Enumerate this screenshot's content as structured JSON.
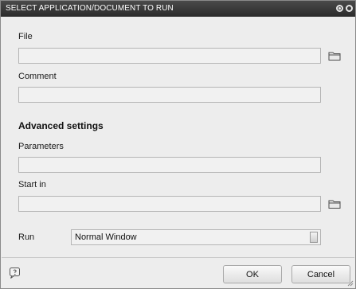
{
  "window": {
    "title": "SELECT APPLICATION/DOCUMENT TO RUN"
  },
  "form": {
    "file": {
      "label": "File",
      "value": "",
      "placeholder": ""
    },
    "comment": {
      "label": "Comment",
      "value": "",
      "placeholder": ""
    },
    "advanced_heading": "Advanced settings",
    "parameters": {
      "label": "Parameters",
      "value": "",
      "placeholder": ""
    },
    "start_in": {
      "label": "Start in",
      "value": "",
      "placeholder": ""
    },
    "run": {
      "label": "Run",
      "selected": "Normal Window"
    }
  },
  "footer": {
    "ok_label": "OK",
    "cancel_label": "Cancel"
  },
  "icons": {
    "titlebar": [
      "restore-icon",
      "close-icon"
    ],
    "browse": "folder-icon",
    "help": "help-icon",
    "resize": "resize-grip-icon"
  },
  "colors": {
    "titlebar": "#333333",
    "dialog_bg": "#ededed",
    "field_bg": "#f1f1f1"
  }
}
